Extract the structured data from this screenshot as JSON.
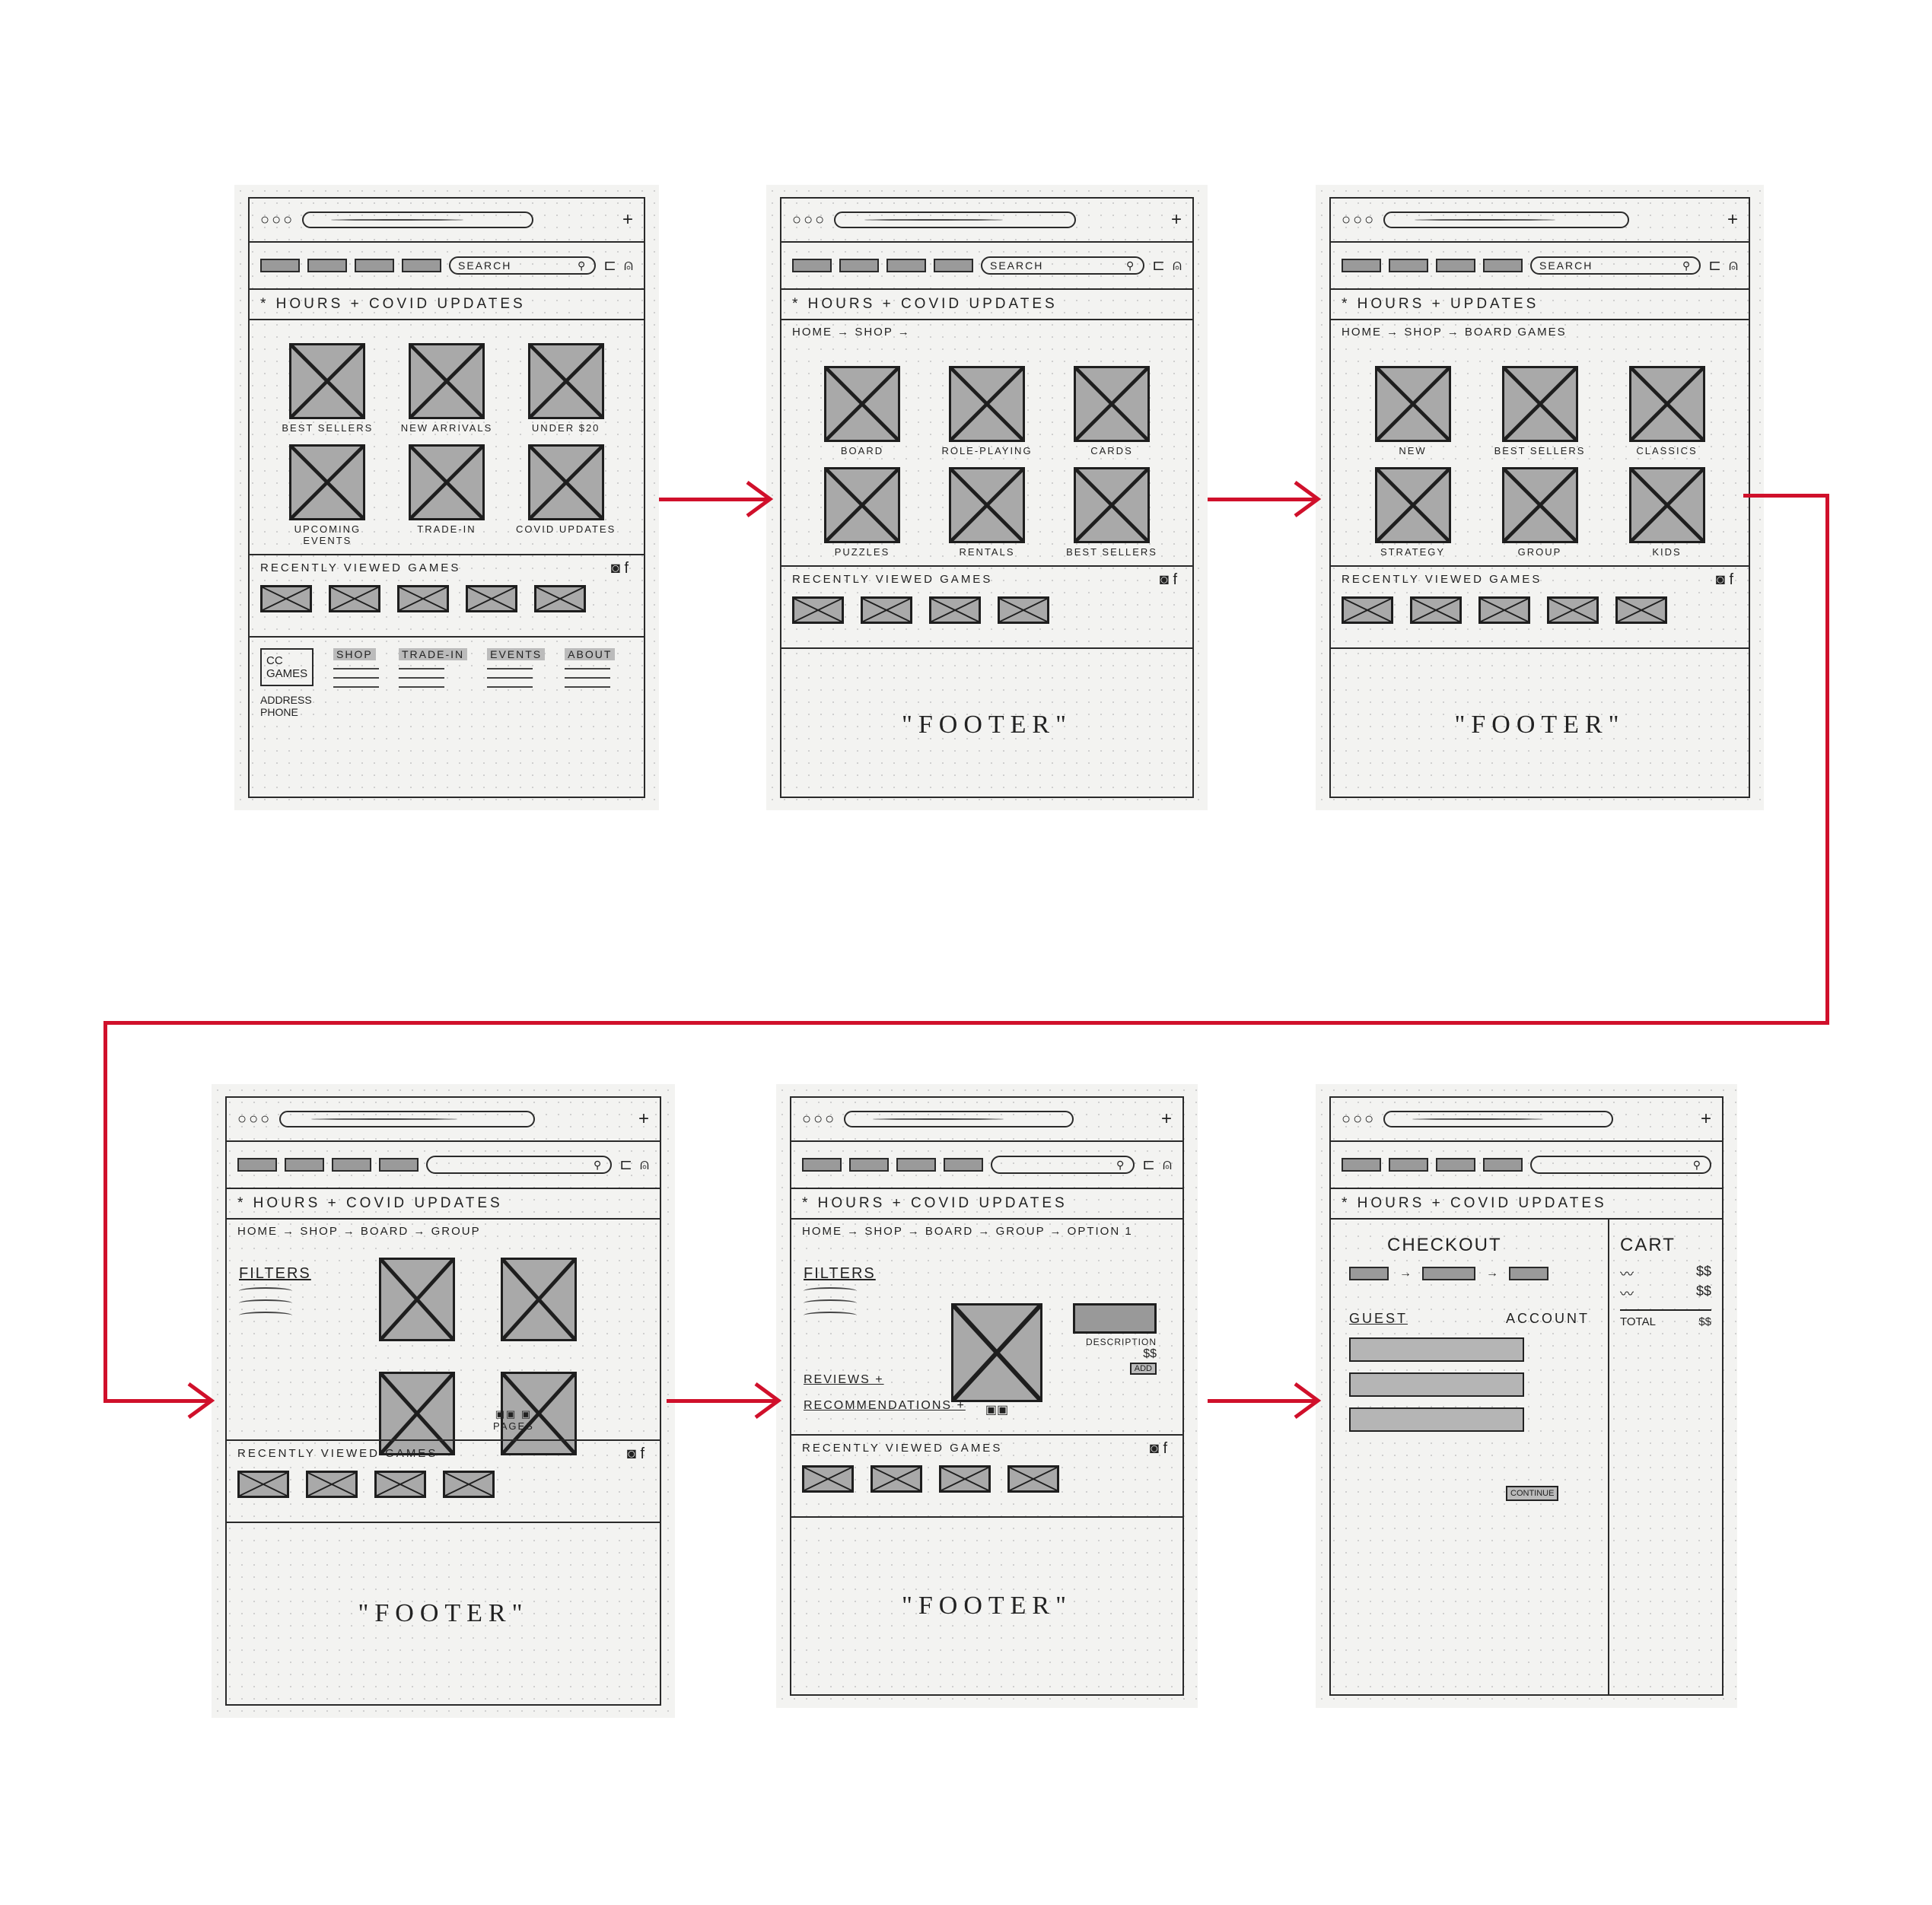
{
  "colors": {
    "arrow": "#d0102b",
    "ink": "#2a2a2a",
    "marker": "#a9a9a9"
  },
  "panels": [
    {
      "search": "SEARCH",
      "announcement": "* HOURS + COVID UPDATES",
      "breadcrumb": "",
      "tiles": [
        "BEST SELLERS",
        "NEW ARRIVALS",
        "UNDER $20",
        "UPCOMING EVENTS",
        "TRADE-IN",
        "COVID UPDATES"
      ],
      "recent_label": "RECENTLY VIEWED GAMES",
      "recent_count": 5,
      "footer": {
        "brand": "CC GAMES",
        "address": "ADDRESS",
        "phone": "PHONE",
        "columns": [
          "SHOP",
          "TRADE-IN",
          "EVENTS",
          "ABOUT"
        ]
      }
    },
    {
      "search": "SEARCH",
      "announcement": "* HOURS + COVID UPDATES",
      "breadcrumb": "HOME → SHOP →",
      "tiles": [
        "BOARD",
        "ROLE-PLAYING",
        "CARDS",
        "PUZZLES",
        "RENTALS",
        "BEST SELLERS"
      ],
      "recent_label": "RECENTLY VIEWED GAMES",
      "recent_count": 4,
      "footer_text": "\"FOOTER\""
    },
    {
      "search": "SEARCH",
      "announcement": "* HOURS + UPDATES",
      "breadcrumb": "HOME → SHOP → BOARD GAMES",
      "tiles": [
        "NEW",
        "BEST SELLERS",
        "CLASSICS",
        "STRATEGY",
        "GROUP",
        "KIDS"
      ],
      "recent_label": "RECENTLY VIEWED GAMES",
      "recent_count": 5,
      "footer_text": "\"FOOTER\""
    },
    {
      "search": "",
      "announcement": "* HOURS + COVID UPDATES",
      "breadcrumb": "HOME → SHOP → BOARD → GROUP",
      "filters": "FILTERS",
      "pages": "PAGES",
      "recent_label": "RECENTLY VIEWED GAMES",
      "recent_count": 4,
      "footer_text": "\"FOOTER\""
    },
    {
      "search": "",
      "announcement": "* HOURS + COVID UPDATES",
      "breadcrumb": "HOME → SHOP → BOARD → GROUP → OPTION 1",
      "filters": "FILTERS",
      "product": {
        "description": "DESCRIPTION",
        "price": "$$",
        "add": "ADD",
        "reviews": "REVIEWS +",
        "recommendations": "RECOMMENDATIONS +"
      },
      "recent_label": "RECENTLY VIEWED GAMES",
      "recent_count": 4,
      "footer_text": "\"FOOTER\""
    },
    {
      "search": "",
      "announcement": "* HOURS + COVID UPDATES",
      "breadcrumb": "",
      "checkout": {
        "title": "CHECKOUT",
        "guest": "GUEST",
        "account": "ACCOUNT",
        "continue": "CONTINUE",
        "cart": "CART",
        "item_prices": [
          "$$",
          "$$"
        ],
        "total_label": "TOTAL",
        "total": "$$"
      }
    }
  ]
}
